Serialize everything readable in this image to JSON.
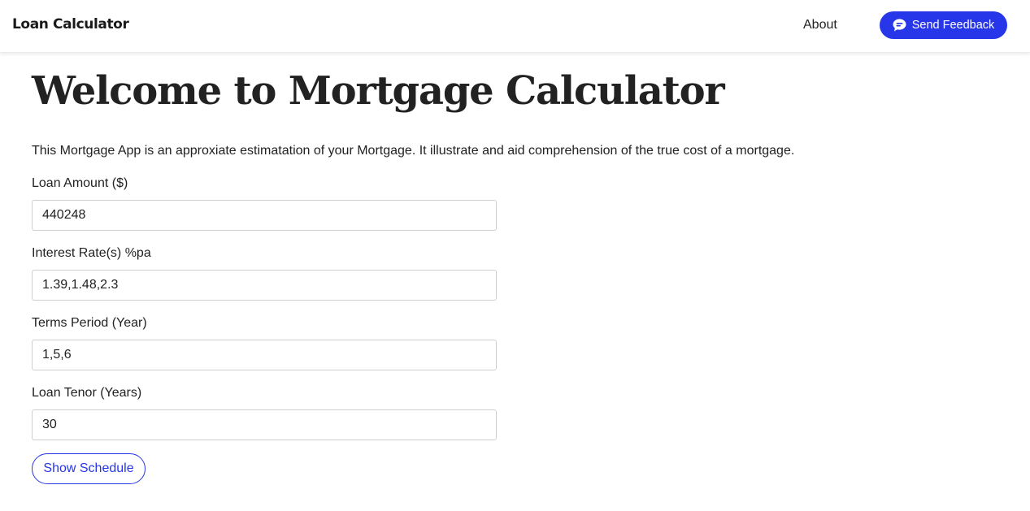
{
  "navbar": {
    "brand": "Loan Calculator",
    "about_label": "About",
    "feedback_label": "Send Feedback",
    "feedback_icon": "chat-bubble-icon",
    "accent_color": "#2636e8"
  },
  "main": {
    "title": "Welcome to Mortgage Calculator",
    "intro": "This Mortgage App is an approxiate estimatation of your Mortgage. It illustrate and aid comprehension of the true cost of a mortgage.",
    "fields": [
      {
        "label": "Loan Amount ($)",
        "value": "440248"
      },
      {
        "label": "Interest Rate(s) %pa",
        "value": "1.39,1.48,2.3"
      },
      {
        "label": "Terms Period (Year)",
        "value": "1,5,6"
      },
      {
        "label": "Loan Tenor (Years)",
        "value": "30"
      }
    ],
    "show_schedule_label": "Show Schedule"
  }
}
